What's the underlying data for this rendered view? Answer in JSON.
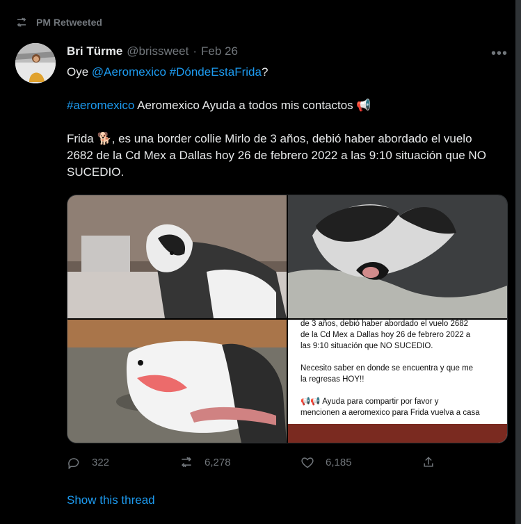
{
  "social_context": {
    "label": "PM Retweeted",
    "icon": "retweet-icon"
  },
  "author": {
    "name": "Bri Türme",
    "handle": "@brissweet",
    "separator": "·",
    "date": "Feb 26"
  },
  "tweet_text": {
    "line1_prefix": "Oye ",
    "mention": "@Aeromexico",
    "space": " ",
    "hashtag1": "#DóndeEstaFrida",
    "line1_suffix": "?",
    "hashtag2": "#aeromexico",
    "line2_rest": " Aeromexico Ayuda a todos mis contactos ",
    "megaphone": "📢",
    "p3_start": "Frida ",
    "dog": "🐕",
    "p3_rest": ", es una border collie Mirlo de 3 años, debió haber abordado el vuelo 2682 de la Cd Mex a Dallas hoy 26 de febrero 2022 a las 9:10 situación que NO SUCEDIO."
  },
  "image_text": {
    "line1": "de 3 años, debió haber abordado el vuelo 2682",
    "line2": "de la Cd Mex a Dallas hoy 26 de febrero 2022 a",
    "line3": "las 9:10 situación que NO SUCEDIO.",
    "line4": "Necesito saber en donde se encuentra y que me",
    "line5": "la regresas HOY!!",
    "line6": "📢📢 Ayuda para compartir por favor y",
    "line7": "mencionen a aeromexico para Frida vuelva a casa"
  },
  "actions": {
    "replies": "322",
    "retweets": "6,278",
    "likes": "6,185"
  },
  "show_thread": "Show this thread",
  "colors": {
    "background": "#000000",
    "text": "#e7e9ea",
    "muted": "#71767b",
    "link": "#1d9bf0"
  }
}
